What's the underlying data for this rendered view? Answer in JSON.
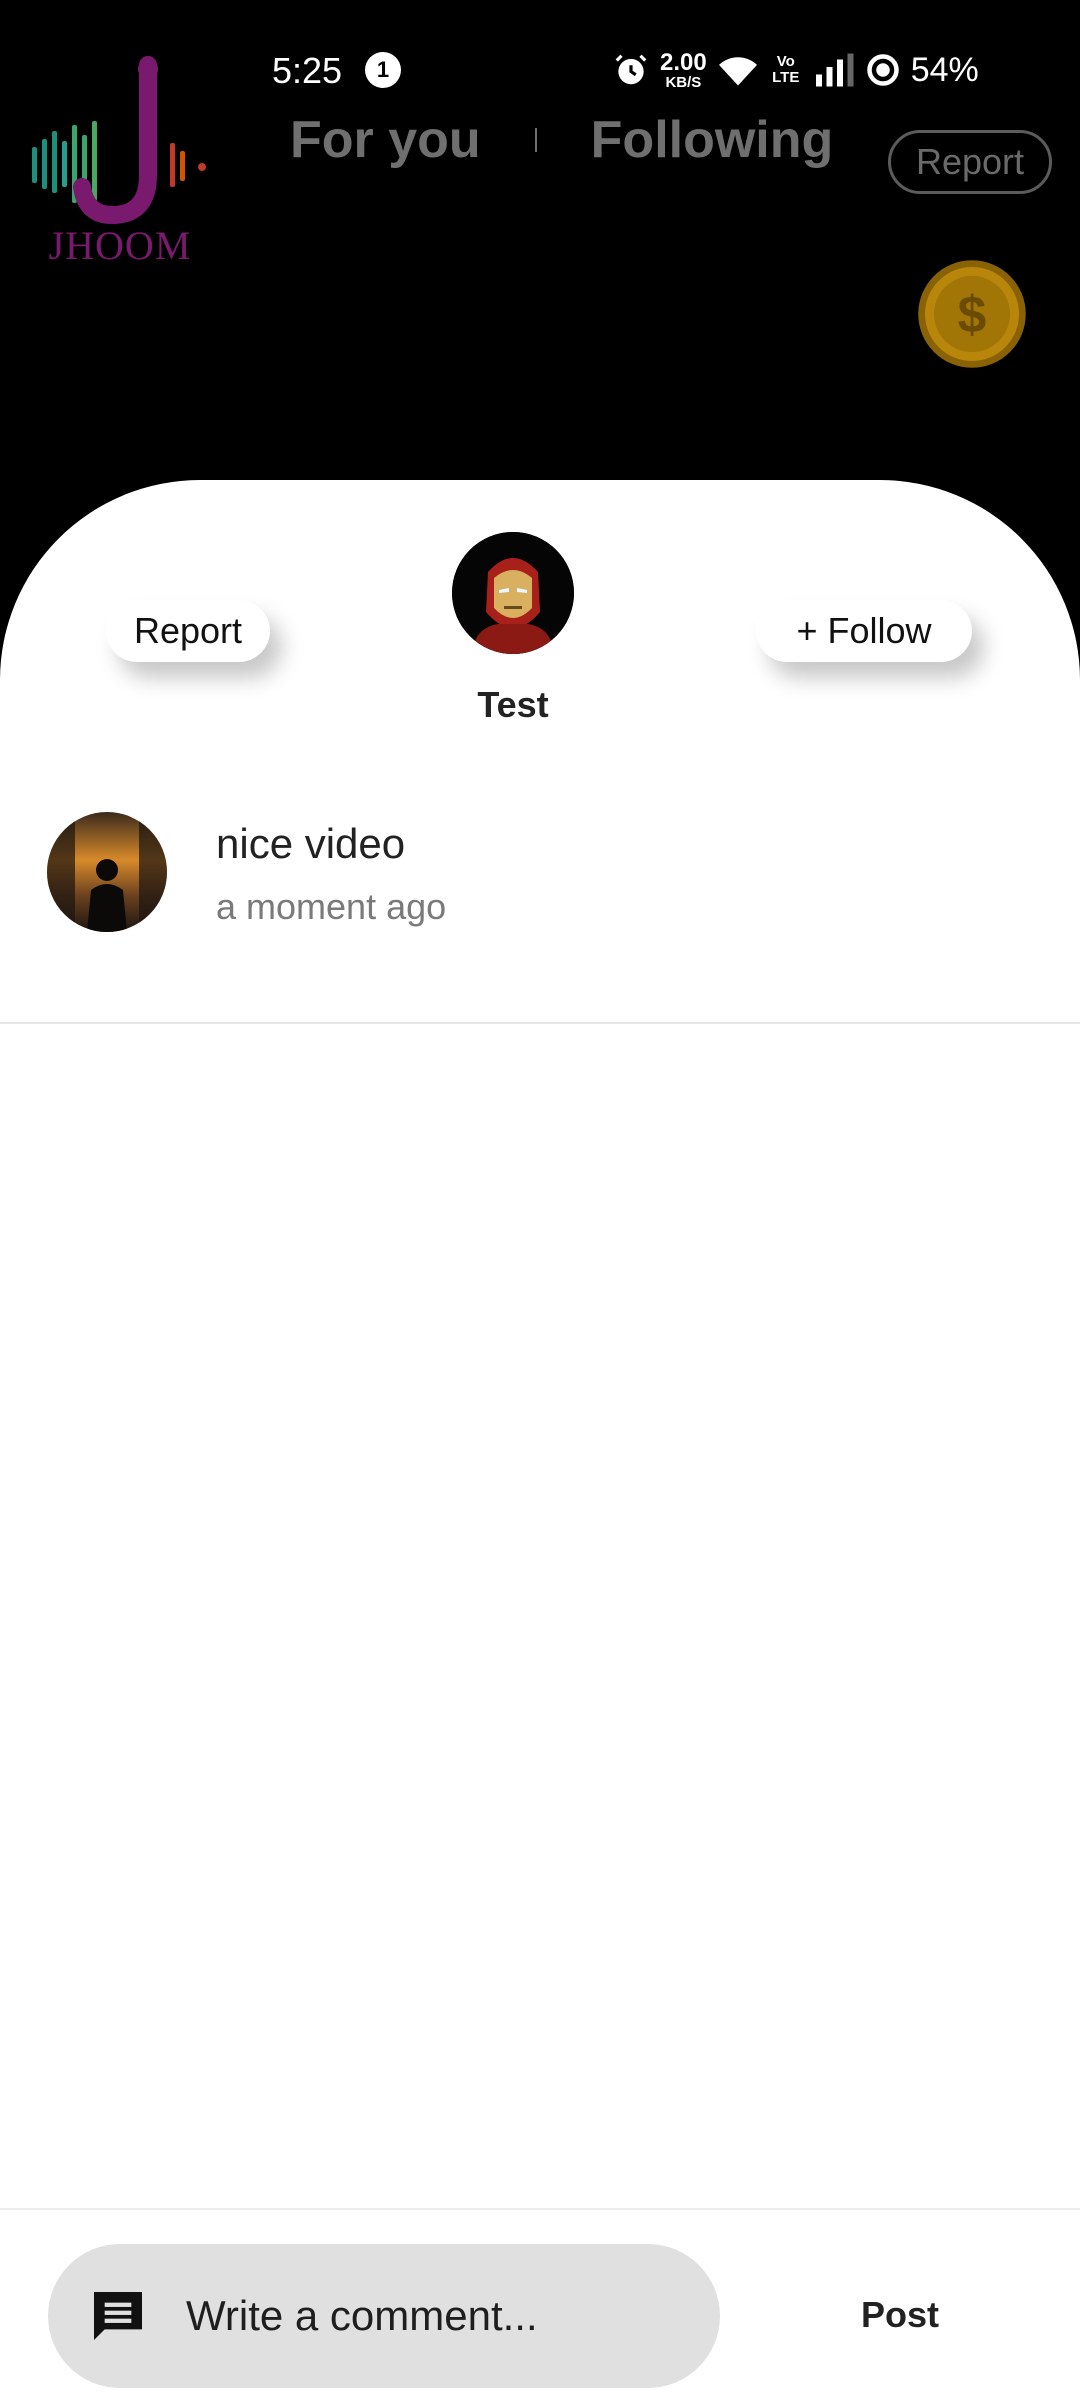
{
  "status_bar": {
    "time": "5:25",
    "notification_count": "1",
    "net_speed_value": "2.00",
    "net_speed_unit": "KB/S",
    "volte_label": "Vo LTE",
    "battery": "54%"
  },
  "brand": {
    "logo_text": "JHOOM"
  },
  "feed_tabs": {
    "for_you": "For you",
    "following": "Following"
  },
  "top_report_label": "Report",
  "sheet": {
    "author_name": "Test",
    "report_label": "Report",
    "follow_label": "+ Follow"
  },
  "comments": [
    {
      "text": "nice video",
      "time": "a moment ago"
    }
  ],
  "composer": {
    "placeholder": "Write a comment...",
    "post_label": "Post"
  },
  "colors": {
    "coin": "#d4a017",
    "logo": "#7a1a6e",
    "input_bg": "#e0e0e0"
  }
}
